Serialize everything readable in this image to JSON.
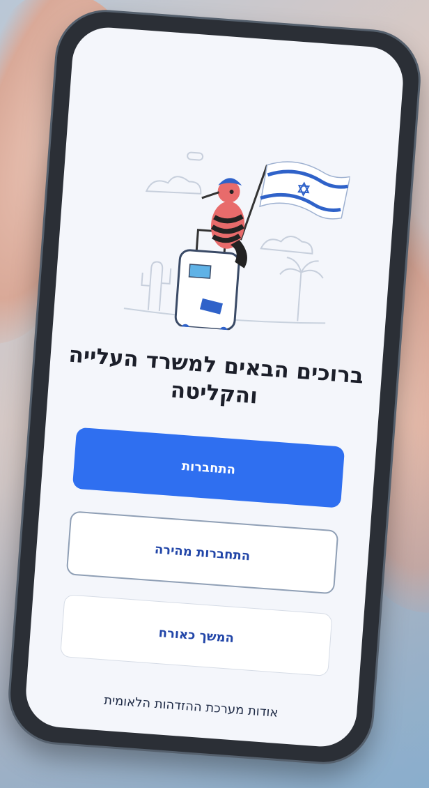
{
  "screen": {
    "welcome_title": "ברוכים הבאים למשרד העלייה והקליטה"
  },
  "buttons": {
    "login": "התחברות",
    "quick_login": "התחברות מהירה",
    "guest": "המשך כאורח"
  },
  "links": {
    "about": "אודות מערכת ההזדהות הלאומית"
  },
  "colors": {
    "primary": "#2f6ff0",
    "button_text": "#2246a8",
    "title": "#1c1f2a",
    "screen_bg": "#f4f6fb"
  },
  "icons": {
    "illustration": "hoopoe-with-israeli-flag-and-suitcase"
  }
}
